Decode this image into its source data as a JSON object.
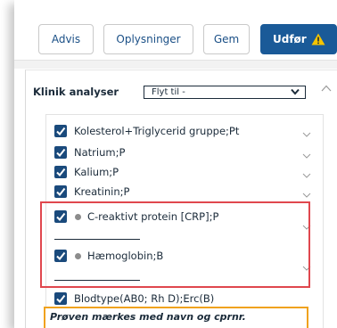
{
  "toolbar": {
    "advis_label": "Advis",
    "oplysninger_label": "Oplysninger",
    "gem_label": "Gem",
    "udfor_label": "Udfør",
    "udfor_color": "#1a5a98",
    "warning_icon": "warning-triangle-icon",
    "warning_color": "#f5c400"
  },
  "section": {
    "title": "Klinik analyser",
    "move_select": {
      "selected": "Flyt til -"
    }
  },
  "analyses": [
    {
      "label": "Kolesterol+Triglycerid gruppe;Pt",
      "checked": true
    },
    {
      "label": "Natrium;P",
      "checked": true
    },
    {
      "label": "Kalium;P",
      "checked": true
    },
    {
      "label": "Kreatinin;P",
      "checked": true
    },
    {
      "label": "C-reaktivt protein [CRP];P",
      "checked": true,
      "status_dot": true
    },
    {
      "label": "Hæmoglobin;B",
      "checked": true,
      "status_dot": true
    },
    {
      "label": "Blodtype(AB0; Rh D);Erc(B)",
      "checked": true
    }
  ],
  "highlight_color": "#e0474e",
  "note": {
    "text": "Prøven mærkes med navn og cprnr.",
    "border_color": "#f0a21e"
  }
}
